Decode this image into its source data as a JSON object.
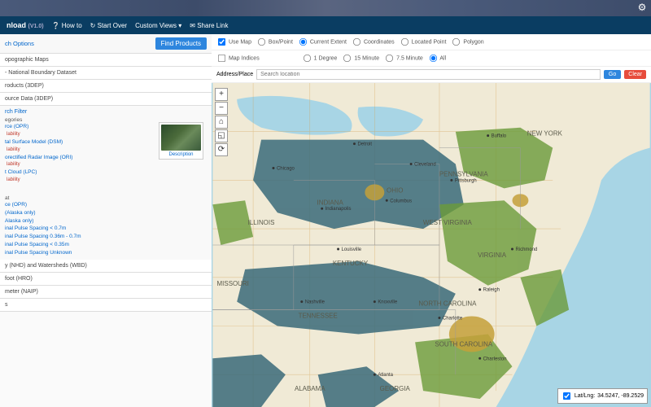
{
  "topbar": {
    "gear_icon": "⚙"
  },
  "navbar": {
    "brand": "nload",
    "version": "(V1.0)",
    "howto": "How to",
    "startover": "Start Over",
    "customviews": "Custom Views ▾",
    "sharelink": "Share Link"
  },
  "left": {
    "options_label": "ch Options",
    "find_btn": "Find Products",
    "sections": {
      "topo": "opographic Maps",
      "natbound": "- National Boundary Dataset",
      "products": "roducts (3DEP)",
      "source": "ource Data (3DEP)"
    },
    "filter_hdr": "rch Filter",
    "categories_hdr": "egories",
    "cats": [
      {
        "name": "rce (OPR)",
        "sub": "lability"
      },
      {
        "name": "tal Surface Model (DSM)",
        "sub": "lability"
      },
      {
        "name": "orectified Radar Image (ORI)",
        "sub": "lability"
      },
      {
        "name": "t Cloud (LPC)",
        "sub": "lability"
      }
    ],
    "thumb_caption": "Description",
    "format_hdr": "at",
    "formats": [
      "ce (OPR)",
      "(Alaska only)",
      "Alaska only)",
      "inal Pulse Spacing < 0.7m",
      "inal Pulse Spacing 0.36m - 0.7m",
      "inal Pulse Spacing < 0.35m",
      "inal Pulse Spacing Unknown"
    ],
    "bottom": {
      "nhd": "y (NHD) and Watersheds (WBD)",
      "hro": "foot (HRO)",
      "naip": "meter (NAIP)",
      "s": "s"
    }
  },
  "mapctrl": {
    "usemap": "Use Map",
    "boxpoint": "Box/Point",
    "curext": "Current Extent",
    "coords": "Coordinates",
    "locpt": "Located Point",
    "polygon": "Polygon",
    "mapidx": "Map Indices",
    "deg1": "1 Degree",
    "min15": "15 Minute",
    "min75": "7.5 Minute",
    "all": "All",
    "addr_label": "Address/Place",
    "search_ph": "Search location",
    "go": "Go",
    "clear": "Clear"
  },
  "map": {
    "coord_label": "Lat/Lng:",
    "coord_val": "34.5247, -89.2529",
    "states": [
      "NEW YORK",
      "PENNSYLVANIA",
      "OHIO",
      "INDIANA",
      "ILLINOIS",
      "WEST VIRGINIA",
      "VIRGINIA",
      "KENTUCKY",
      "TENNESSEE",
      "NORTH CAROLINA",
      "SOUTH CAROLINA",
      "GEORGIA",
      "ALABAMA",
      "MISSOURI"
    ],
    "cities": [
      "Atlanta",
      "Charleston",
      "Charlotte",
      "Nashville",
      "Louisville",
      "Indianapolis",
      "Columbus",
      "Pittsburgh",
      "Buffalo",
      "Cleveland",
      "Detroit",
      "Chicago",
      "Raleigh",
      "Richmond",
      "Knoxville"
    ]
  }
}
